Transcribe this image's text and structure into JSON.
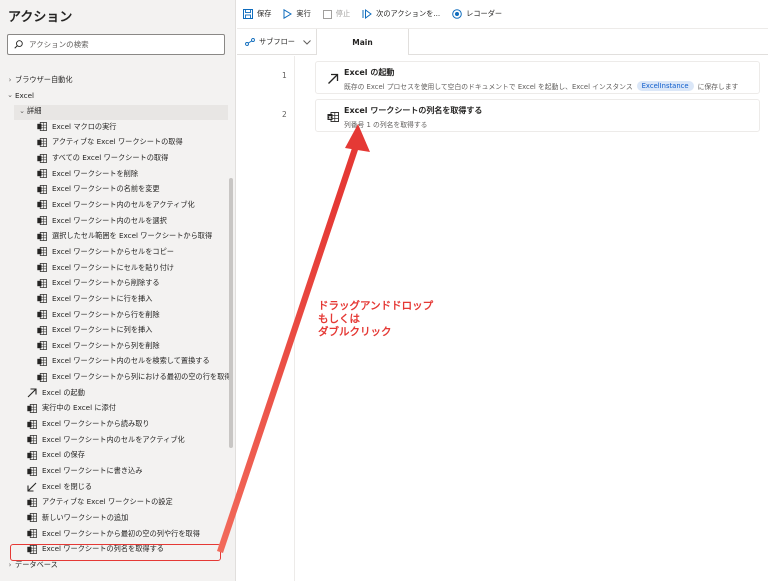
{
  "actions_panel": {
    "title": "アクション",
    "search_placeholder": "アクションの検索",
    "groups": {
      "browser": "ブラウザー自動化",
      "excel": "Excel",
      "advanced": "詳細",
      "database": "データベース"
    },
    "advanced_items": [
      "Excel マクロの実行",
      "アクティブな Excel ワークシートの取得",
      "すべての Excel ワークシートの取得",
      "Excel ワークシートを削除",
      "Excel ワークシートの名前を変更",
      "Excel ワークシート内のセルをアクティブ化",
      "Excel ワークシート内のセルを選択",
      "選択したセル範囲を Excel ワークシートから取得",
      "Excel ワークシートからセルをコピー",
      "Excel ワークシートにセルを貼り付け",
      "Excel ワークシートから削除する",
      "Excel ワークシートに行を挿入",
      "Excel ワークシートから行を削除",
      "Excel ワークシートに列を挿入",
      "Excel ワークシートから列を削除",
      "Excel ワークシート内のセルを検索して置換する",
      "Excel ワークシートから列における最初の空の行を取得"
    ],
    "excel_items": [
      {
        "label": "Excel の起動",
        "icon": "launch-arrow-icon"
      },
      {
        "label": "実行中の Excel に添付",
        "icon": "excel-icon"
      },
      {
        "label": "Excel ワークシートから読み取り",
        "icon": "excel-icon"
      },
      {
        "label": "Excel ワークシート内のセルをアクティブ化",
        "icon": "excel-icon"
      },
      {
        "label": "Excel の保存",
        "icon": "excel-icon"
      },
      {
        "label": "Excel ワークシートに書き込み",
        "icon": "excel-icon"
      },
      {
        "label": "Excel を閉じる",
        "icon": "close-arrow-icon"
      },
      {
        "label": "アクティブな Excel ワークシートの設定",
        "icon": "excel-icon"
      },
      {
        "label": "新しいワークシートの追加",
        "icon": "excel-icon"
      },
      {
        "label": "Excel ワークシートから最初の空の列や行を取得",
        "icon": "excel-icon"
      },
      {
        "label": "Excel ワークシートの列名を取得する",
        "icon": "excel-icon"
      }
    ]
  },
  "toolbar": {
    "save": "保存",
    "run": "実行",
    "stop": "停止",
    "next_action": "次のアクションを...",
    "recorder": "レコーダー"
  },
  "tabs": {
    "subflow": "サブフロー",
    "main": "Main"
  },
  "steps": [
    {
      "number": "1",
      "title": "Excel の起動",
      "desc_before": "既存の Excel プロセスを使用して空白のドキュメントで Excel を起動し、Excel インスタンス",
      "variable": "ExcelInstance",
      "desc_after": "に保存します"
    },
    {
      "number": "2",
      "title": "Excel ワークシートの列名を取得する",
      "desc": "列番号 1 の列名を取得する"
    }
  ],
  "annotation": {
    "line1": "ドラッグアンドドロップ",
    "line2": "もしくは",
    "line3": "ダブルクリック"
  },
  "colors": {
    "accent": "#0f6cbd",
    "annotation_red": "#e53935",
    "variable_badge_bg": "#dbe7f8"
  }
}
